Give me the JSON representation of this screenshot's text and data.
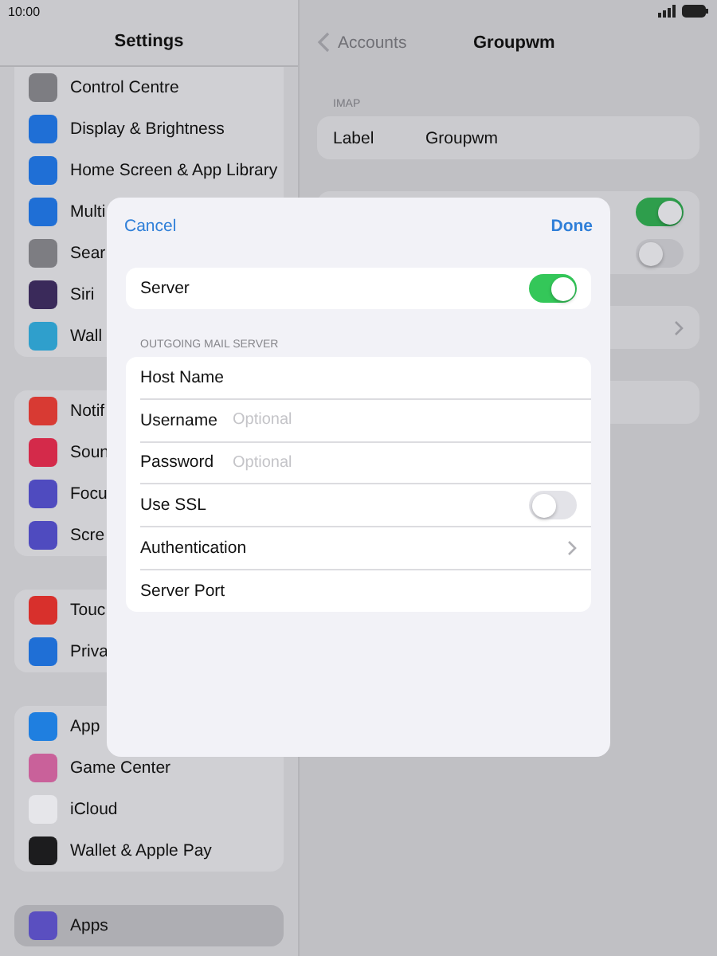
{
  "status_bar": {
    "time": "10:00"
  },
  "sidebar": {
    "title": "Settings",
    "groups": [
      [
        {
          "label": "Control Centre",
          "color": "#7d7d82",
          "selected": false
        },
        {
          "label": "Display & Brightness",
          "color": "#1f6fd6",
          "selected": false
        },
        {
          "label": "Home Screen & App Library",
          "color": "#1f6fd6",
          "selected": false
        },
        {
          "label": "Multi",
          "color": "#1f6fd6",
          "selected": false
        },
        {
          "label": "Sear",
          "color": "#7d7d82",
          "selected": false
        },
        {
          "label": "Siri",
          "color": "#3a2a5a",
          "selected": false
        },
        {
          "label": "Wall",
          "color": "#2f9fcc",
          "selected": false
        }
      ],
      [
        {
          "label": "Notif",
          "color": "#d83a33",
          "selected": false
        },
        {
          "label": "Soun",
          "color": "#d42a4a",
          "selected": false
        },
        {
          "label": "Focu",
          "color": "#4f4bbf",
          "selected": false
        },
        {
          "label": "Scre",
          "color": "#4f4bbf",
          "selected": false
        }
      ],
      [
        {
          "label": "Touc",
          "color": "#d8302c",
          "selected": false
        },
        {
          "label": "Priva",
          "color": "#1f6fd6",
          "selected": false
        }
      ],
      [
        {
          "label": "App",
          "color": "#1f7fe0",
          "selected": false
        },
        {
          "label": "Game Center",
          "color": "#c9619a",
          "selected": false
        },
        {
          "label": "iCloud",
          "color": "#e6e6ea",
          "selected": false
        },
        {
          "label": "Wallet & Apple Pay",
          "color": "#1c1c1e",
          "selected": false
        }
      ],
      [
        {
          "label": "Apps",
          "color": "#5a4fc0",
          "selected": true
        }
      ]
    ]
  },
  "detail": {
    "back": "Accounts",
    "title": "Groupwm",
    "section": "IMAP",
    "label_row": {
      "label": "Label",
      "value": "Groupwm"
    },
    "toggles": [
      {
        "on": true
      },
      {
        "on": false
      }
    ]
  },
  "dialog": {
    "cancel": "Cancel",
    "done": "Done",
    "server": {
      "label": "Server",
      "on": true
    },
    "section": "OUTGOING MAIL SERVER",
    "rows": [
      {
        "kind": "field",
        "label": "Host Name"
      },
      {
        "kind": "field",
        "label": "Username",
        "placeholder": "Optional"
      },
      {
        "kind": "field",
        "label": "Password",
        "placeholder": "Optional"
      },
      {
        "kind": "toggle",
        "label": "Use SSL",
        "on": false
      },
      {
        "kind": "link",
        "label": "Authentication"
      },
      {
        "kind": "field",
        "label": "Server Port"
      }
    ]
  }
}
